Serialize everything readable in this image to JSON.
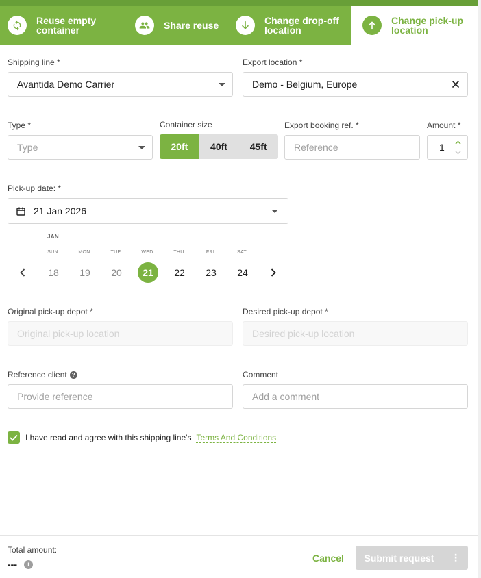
{
  "colors": {
    "accent": "#7cb342",
    "accent_dark": "#689f38",
    "disabled": "#d6d6d6"
  },
  "tabs": [
    {
      "label": "Reuse empty container",
      "icon": "sync-icon",
      "active": false
    },
    {
      "label": "Share reuse",
      "icon": "people-icon",
      "active": false
    },
    {
      "label": "Change drop-off location",
      "icon": "arrow-down-icon",
      "active": false
    },
    {
      "label": "Change pick-up location",
      "icon": "arrow-up-icon",
      "active": true
    }
  ],
  "form": {
    "shipping_line": {
      "label": "Shipping line *",
      "value": "Avantida Demo Carrier"
    },
    "export_location": {
      "label": "Export location *",
      "value": "Demo - Belgium, Europe"
    },
    "type": {
      "label": "Type *",
      "placeholder": "Type"
    },
    "container_size": {
      "label": "Container size",
      "options": [
        "20ft",
        "40ft",
        "45ft"
      ],
      "selected": "20ft"
    },
    "export_booking_ref": {
      "label": "Export booking ref. *",
      "placeholder": "Reference"
    },
    "amount": {
      "label": "Amount *",
      "value": "1"
    },
    "pickup_date": {
      "label": "Pick-up date: *",
      "value": "21 Jan 2026"
    },
    "original_depot": {
      "label": "Original pick-up depot *",
      "placeholder": "Original pick-up location"
    },
    "desired_depot": {
      "label": "Desired pick-up depot *",
      "placeholder": "Desired pick-up location"
    },
    "reference_client": {
      "label": "Reference client",
      "placeholder": "Provide reference"
    },
    "comment": {
      "label": "Comment",
      "placeholder": "Add a comment"
    }
  },
  "calendar": {
    "month": "JAN",
    "days": [
      {
        "dow": "SUN",
        "num": "18",
        "state": "past"
      },
      {
        "dow": "MON",
        "num": "19",
        "state": "past"
      },
      {
        "dow": "TUE",
        "num": "20",
        "state": "past"
      },
      {
        "dow": "WED",
        "num": "21",
        "state": "selected"
      },
      {
        "dow": "THU",
        "num": "22",
        "state": "normal"
      },
      {
        "dow": "FRI",
        "num": "23",
        "state": "normal"
      },
      {
        "dow": "SAT",
        "num": "24",
        "state": "normal"
      }
    ]
  },
  "agreement": {
    "text": "I have read and agree with this shipping line's",
    "link": "Terms And Conditions",
    "checked": true
  },
  "footer": {
    "total_label": "Total amount:",
    "total_value": "---",
    "cancel": "Cancel",
    "submit": "Submit request",
    "more": "⋮"
  }
}
